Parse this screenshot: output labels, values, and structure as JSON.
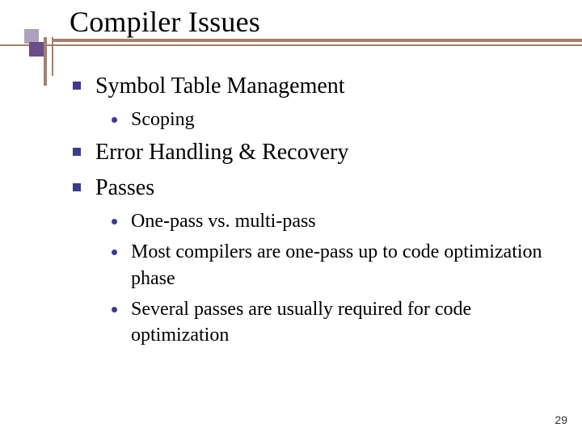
{
  "slide": {
    "title": "Compiler Issues",
    "bullets": [
      {
        "text": "Symbol Table Management",
        "children": [
          {
            "text": "Scoping"
          }
        ]
      },
      {
        "text": "Error Handling & Recovery"
      },
      {
        "text": "Passes",
        "children": [
          {
            "text": "One-pass vs. multi-pass"
          },
          {
            "text": "Most compilers are one-pass up to code optimization phase"
          },
          {
            "text": "Several passes are usually required for code optimization"
          }
        ]
      }
    ],
    "page_number": "29"
  }
}
